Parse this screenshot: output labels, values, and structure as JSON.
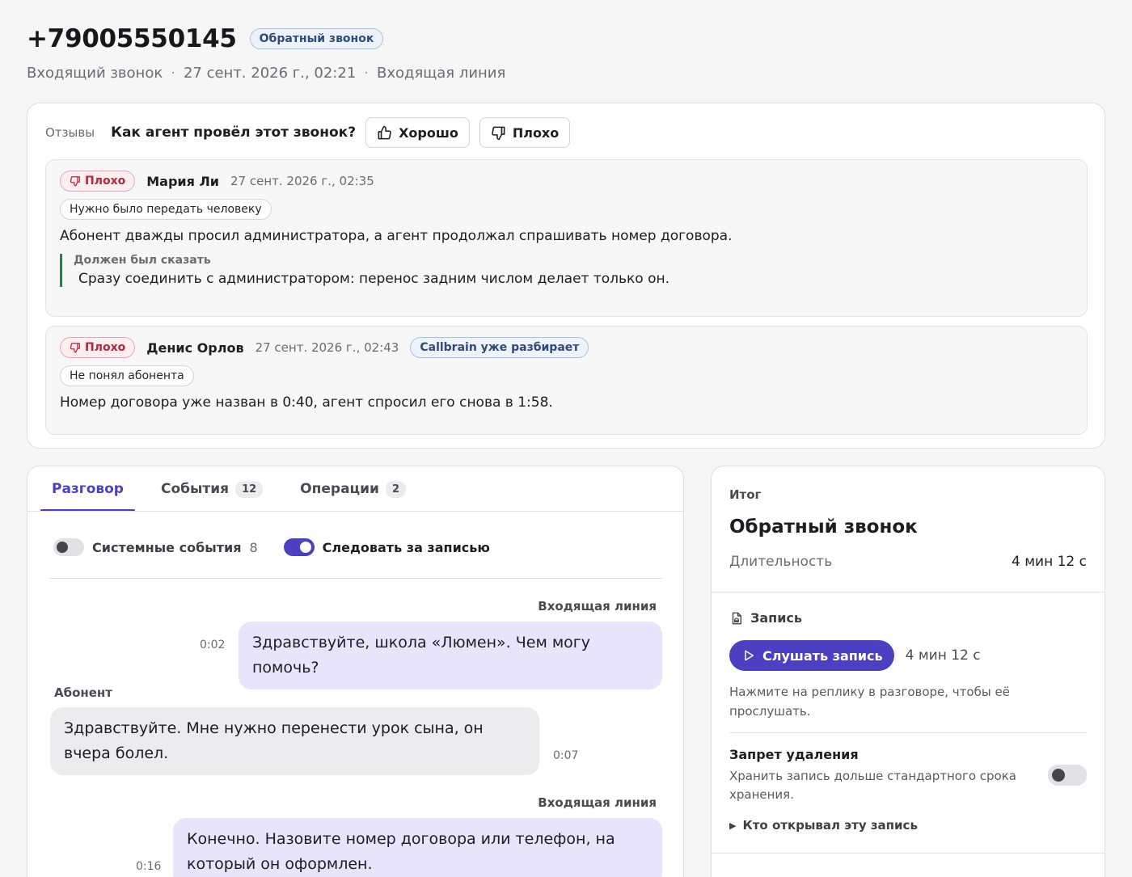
{
  "header": {
    "phone": "+79005550145",
    "badge": "Обратный звонок",
    "call_type": "Входящий звонок",
    "datetime": "27 сент. 2026 г., 02:21",
    "line": "Входящая линия",
    "separator": "·"
  },
  "reviews": {
    "label": "Отзывы",
    "question": "Как агент провёл этот звонок?",
    "good_label": "Хорошо",
    "bad_label": "Плохо",
    "items": [
      {
        "rating": "Плохо",
        "author": "Мария Ли",
        "date": "27 сент. 2026 г., 02:35",
        "tag": "Нужно было передать человеку",
        "text": "Абонент дважды просил администратора, а агент продолжал спрашивать номер договора.",
        "quote_label": "Должен был сказать",
        "quote_text": "Сразу соединить с администратором: перенос задним числом делает только он."
      },
      {
        "rating": "Плохо",
        "author": "Денис Орлов",
        "date": "27 сент. 2026 г., 02:43",
        "status": "Callbrain уже разбирает",
        "tag": "Не понял абонента",
        "text": "Номер договора уже назван в 0:40, агент спросил его снова в 1:58."
      }
    ]
  },
  "conversation": {
    "tabs": [
      {
        "label": "Разговор",
        "active": true
      },
      {
        "label": "События",
        "count": "12"
      },
      {
        "label": "Операции",
        "count": "2"
      }
    ],
    "system_events_label": "Системные события",
    "system_events_count": "8",
    "system_events_enabled": false,
    "follow_label": "Следовать за записью",
    "follow_enabled": true,
    "messages": [
      {
        "speaker": "Входящая линия",
        "role": "agent",
        "time": "0:02",
        "text": "Здравствуйте, школа «Люмен». Чем могу помочь?"
      },
      {
        "speaker": "Абонент",
        "role": "user",
        "time": "0:07",
        "text": "Здравствуйте. Мне нужно перенести урок сына, он вчера болел."
      },
      {
        "speaker": "Входящая линия",
        "role": "agent",
        "time": "0:16",
        "text": "Конечно. Назовите номер договора или телефон, на который он оформлен."
      }
    ]
  },
  "summary": {
    "section_label": "Итог",
    "title": "Обратный звонок",
    "duration_label": "Длительность",
    "duration_value": "4 мин 12 с",
    "record_label": "Запись",
    "play_label": "Слушать запись",
    "record_duration": "4 мин 12 с",
    "hint": "Нажмите на реплику в разговоре, чтобы её прослушать.",
    "lock_title": "Запрет удаления",
    "lock_text": "Хранить запись дольше стандартного срока хранения.",
    "lock_enabled": false,
    "who_opened": "Кто открывал эту запись"
  },
  "colors": {
    "accent": "#4b3fc2",
    "agent_bubble": "#e7e4fb",
    "user_bubble": "#ececef",
    "bad": "#b3263b",
    "quote_bar": "#2f7d4f",
    "badge_blue": "#2d4a7d"
  },
  "icons": [
    "thumbs-up-icon",
    "thumbs-down-icon",
    "record-file-icon",
    "play-icon",
    "triangle-right-icon"
  ]
}
